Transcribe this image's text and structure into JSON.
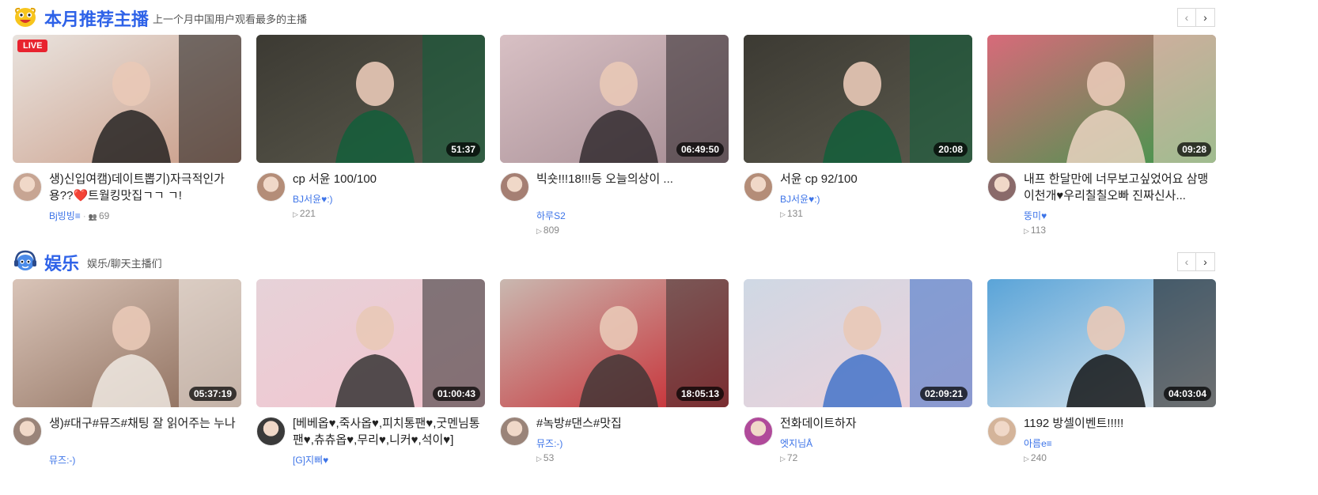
{
  "sections": [
    {
      "title": "本月推荐主播",
      "subtitle": "上一个月中国用户观看最多的主播",
      "icon": "smiley-mascot-icon",
      "pager": {
        "prev": "‹",
        "next": "›"
      },
      "cards": [
        {
          "live_label": "LIVE",
          "title": "생)신입여캠)데이트뽑기)자극적인가용??❤️트월킹맛집ㄱㄱ ㄱ!",
          "streamer": "Bj빙빙≡",
          "viewers": "69",
          "thumb_colors": [
            "#e9e3de",
            "#c99b86",
            "#1a1a1a"
          ],
          "avatar_color": "#c7a593"
        },
        {
          "duration": "51:37",
          "title": "cp 서윤 100/100",
          "streamer": "BJ서윤♥:)",
          "views": "221",
          "thumb_colors": [
            "#3c3a33",
            "#5c5a4d",
            "#0f5f3a"
          ],
          "avatar_color": "#b48d78"
        },
        {
          "duration": "06:49:50",
          "title": "빅숏!!!18!!!등 오늘의상이 ...",
          "streamer": "하루S2",
          "views": "809",
          "thumb_colors": [
            "#d8c0c4",
            "#a58c93",
            "#2a2428"
          ],
          "avatar_color": "#a57f73"
        },
        {
          "duration": "20:08",
          "title": "서윤 cp 92/100",
          "streamer": "BJ서윤♥:)",
          "views": "131",
          "thumb_colors": [
            "#3c3a33",
            "#5c5a4d",
            "#0f5f3a"
          ],
          "avatar_color": "#b48d78"
        },
        {
          "duration": "09:28",
          "title": "내프 한달만에 너무보고싶었어요 삼맹이천개♥우리칠칠오빠 진짜신사...",
          "streamer": "뚱미♥",
          "views": "113",
          "thumb_colors": [
            "#d86a7a",
            "#3a9a4a",
            "#f3d8c8"
          ],
          "avatar_color": "#8a6a6a"
        }
      ]
    },
    {
      "title": "娱乐",
      "subtitle": "娱乐/聊天主播们",
      "icon": "mascot-headset-icon",
      "pager": {
        "prev": "‹",
        "next": "›"
      },
      "cards": [
        {
          "duration": "05:37:19",
          "title": "생)#대구#뮤즈#채팅 잘 읽어주는 누나",
          "streamer": "뮤즈:-)",
          "thumb_colors": [
            "#d9c4b8",
            "#8a6a58",
            "#f4efe9"
          ],
          "avatar_color": "#9a8479"
        },
        {
          "duration": "01:00:43",
          "title": "[베베옵♥,죽사옵♥,피치통팬♥,굿멘님통팬♥,츄츄옵♥,무리♥,니커♥,석이♥]",
          "streamer": "[G]지삐♥",
          "thumb_colors": [
            "#e6d2d8",
            "#f4c4cf",
            "#2a2a2a"
          ],
          "avatar_color": "#3a3a3a"
        },
        {
          "duration": "18:05:13",
          "title": "#녹방#댄스#맛집",
          "streamer": "뮤즈:-)",
          "views": "53",
          "thumb_colors": [
            "#c9b8b0",
            "#c8242c",
            "#3a3535"
          ],
          "avatar_color": "#9a8479"
        },
        {
          "duration": "02:09:21",
          "title": "전화데이트하자",
          "streamer": "엣지님Å",
          "views": "72",
          "thumb_colors": [
            "#cfd8e4",
            "#f0d0d8",
            "#3a6ec8"
          ],
          "avatar_color": "#b04a9a"
        },
        {
          "duration": "04:03:04",
          "title": "1192 방셀이벤트!!!!!",
          "streamer": "아름e≡",
          "views": "240",
          "thumb_colors": [
            "#5aa4d8",
            "#e8ecef",
            "#0a0a0a"
          ],
          "avatar_color": "#d4b49a"
        }
      ]
    }
  ]
}
